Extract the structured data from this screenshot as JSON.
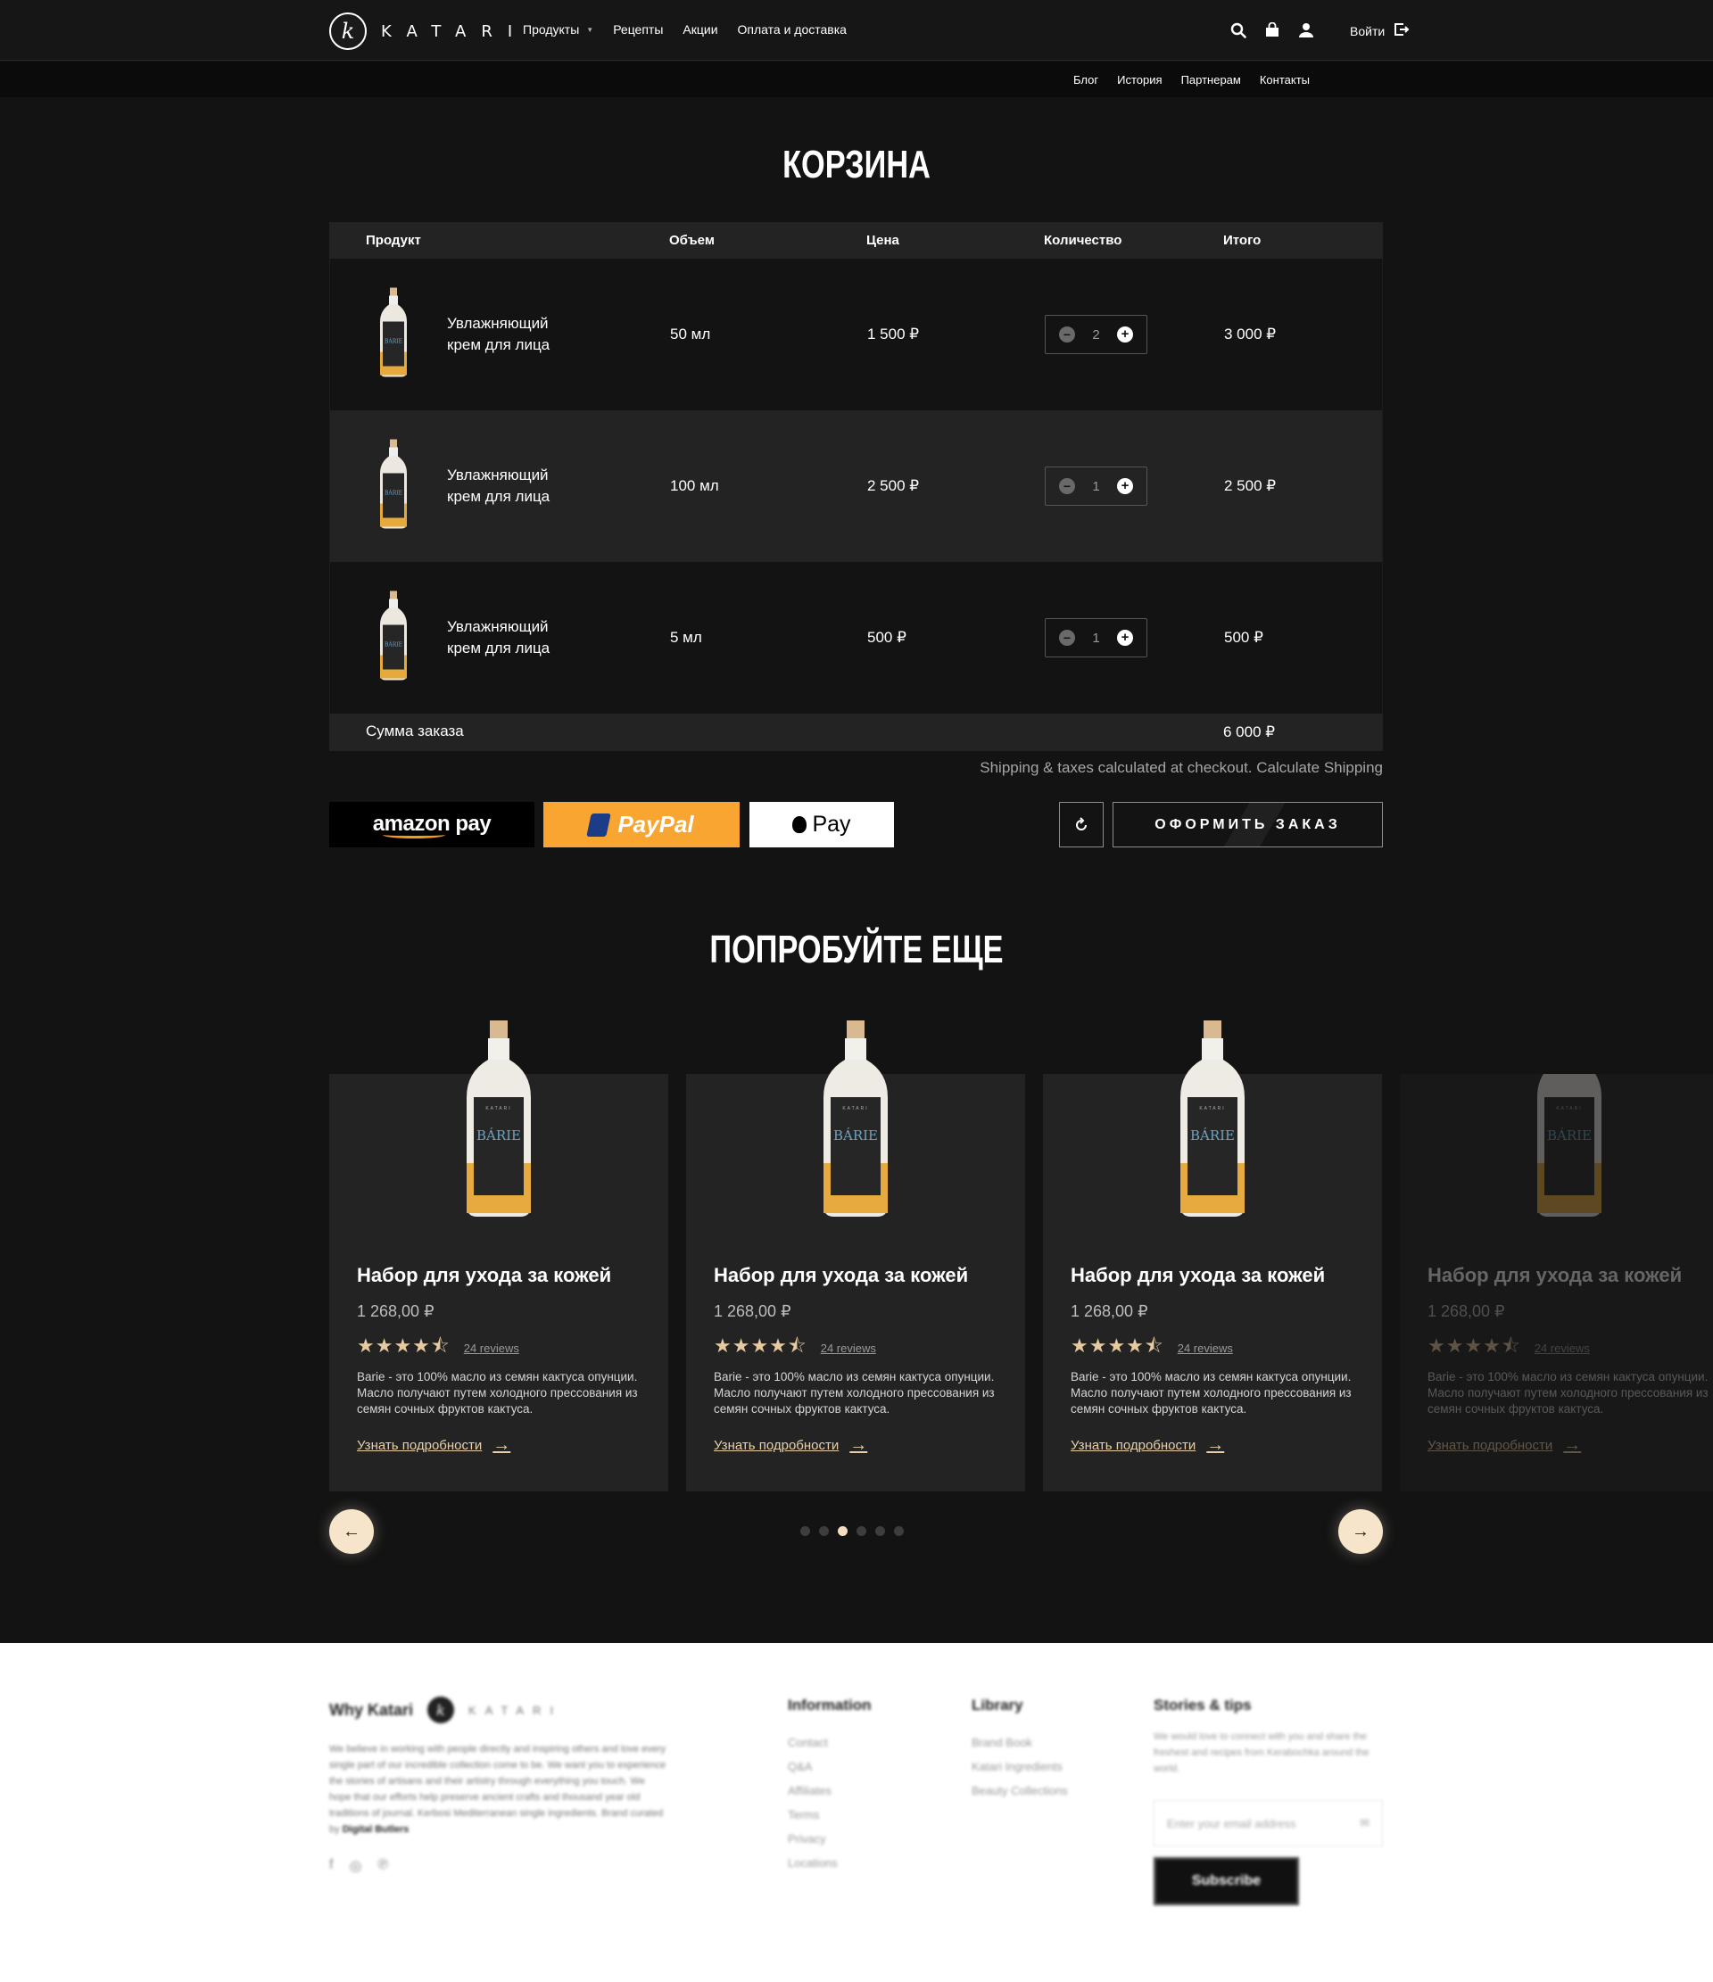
{
  "header": {
    "logo_text": "KATARI",
    "logo_letter": "k",
    "nav": [
      {
        "label": "Продукты",
        "has_dropdown": true
      },
      {
        "label": "Рецепты"
      },
      {
        "label": "Акции"
      },
      {
        "label": "Оплата и доставка"
      }
    ],
    "login_label": "Войти",
    "subnav": [
      "Блог",
      "История",
      "Партнерам",
      "Контакты"
    ]
  },
  "cart": {
    "title": "КОРЗИНА",
    "columns": [
      "Продукт",
      "Объем",
      "Цена",
      "Количество",
      "Итого"
    ],
    "rows": [
      {
        "name": "Увлажняющий крем для лица",
        "volume": "50 мл",
        "price": "1 500 ₽",
        "qty": "2",
        "total": "3 000 ₽"
      },
      {
        "name": "Увлажняющий крем для лица",
        "volume": "100 мл",
        "price": "2 500 ₽",
        "qty": "1",
        "total": "2 500 ₽"
      },
      {
        "name": "Увлажняющий крем для лица",
        "volume": "5 мл",
        "price": "500 ₽",
        "qty": "1",
        "total": "500 ₽"
      }
    ],
    "sum_label": "Сумма заказа",
    "sum_value": "6 000 ₽",
    "shipping_note": "Shipping & taxes calculated at checkout. Calculate Shipping",
    "pay_amazon": "amazon pay",
    "pay_paypal": "PayPal",
    "pay_apple": "Pay",
    "order_button": "ОФОРМИТЬ ЗАКАЗ"
  },
  "try_more": {
    "title": "ПОПРОБУЙТЕ ЕЩЕ",
    "cards": [
      {
        "title": "Набор для ухода за кожей",
        "price": "1 268,00 ₽",
        "stars": "★★★★⯪",
        "reviews": "24 reviews",
        "desc": "Barie - это 100% масло из семян кактуса опунции. Масло получают путем холодного прессования из семян сочных фруктов кактуса.",
        "more": "Узнать подробности"
      },
      {
        "title": "Набор для ухода за кожей",
        "price": "1 268,00 ₽",
        "stars": "★★★★⯪",
        "reviews": "24 reviews",
        "desc": "Barie - это 100% масло из семян кактуса опунции. Масло получают путем холодного прессования из семян сочных фруктов кактуса.",
        "more": "Узнать подробности"
      },
      {
        "title": "Набор для ухода за кожей",
        "price": "1 268,00 ₽",
        "stars": "★★★★⯪",
        "reviews": "24 reviews",
        "desc": "Barie - это 100% масло из семян кактуса опунции. Масло получают путем холодного прессования из семян сочных фруктов кактуса.",
        "more": "Узнать подробности"
      },
      {
        "title": "Набор для ухода за кожей",
        "price": "1 268,00 ₽",
        "stars": "★★★★⯪",
        "reviews": "24 reviews",
        "desc": "Barie - это 100% масло из семян кактуса опунции. Масло получают путем холодного прессования из семян сочных фруктов кактуса.",
        "more": "Узнать подробности"
      }
    ],
    "dots_count": 6,
    "active_dot": 3,
    "bottle_label": "BÁRIE",
    "bottle_brand": "KATARI"
  },
  "footer": {
    "why_title": "Why Katari",
    "why_logo_word": "KATARI",
    "about": "We believe in working with people directly and inspiring others and love every single part of our incredible collection come to be. We want you to experience the stories of artisans and their artistry through everything you touch. We hope that our efforts help preserve ancient crafts and thousand year old traditions of journal. Kerbosi Mediterranean single ingredients. Brand curated by",
    "about_credit": "Digital Butlers",
    "information_title": "Information",
    "information_items": [
      "Contact",
      "Q&A",
      "Affiliates",
      "Terms",
      "Privacy",
      "Locations"
    ],
    "library_title": "Library",
    "library_items": [
      "Brand Book",
      "Katari Ingredients",
      "Beauty Collections"
    ],
    "stories_title": "Stories & tips",
    "stories_desc": "We would love to connect with you and share the freshest and recipes from Kerabochka around the world.",
    "email_placeholder": "Enter your email address",
    "subscribe": "Subscribe"
  },
  "colors": {
    "accent": "#f3dfbf",
    "paypal": "#f8a532",
    "background": "#131313",
    "panel": "#232323"
  }
}
